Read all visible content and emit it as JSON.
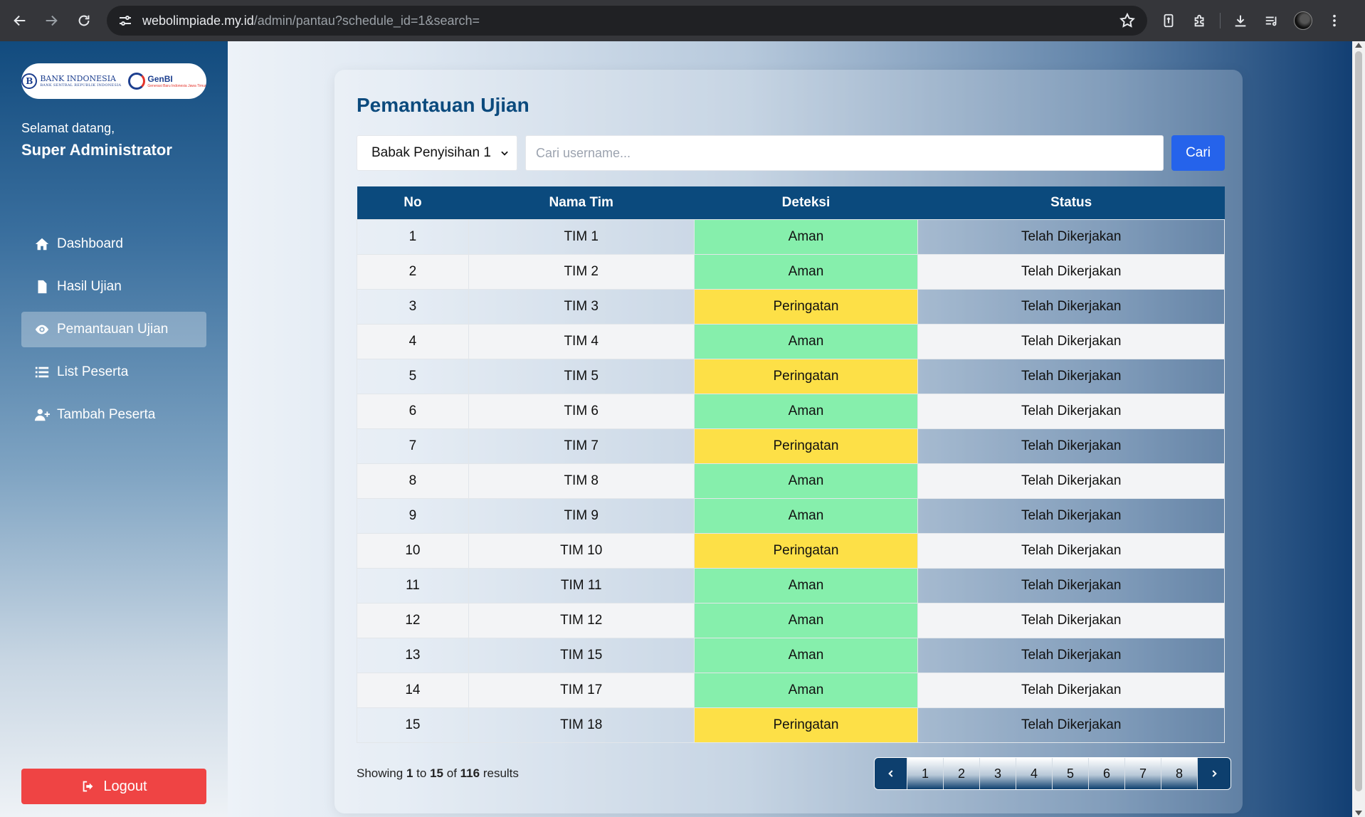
{
  "browser": {
    "url_host": "webolimpiade.my.id",
    "url_rest": "/admin/pantau?schedule_id=1&search="
  },
  "sidebar": {
    "logo_bi_text": "BANK INDONESIA",
    "logo_bi_sub": "BANK SENTRAL REPUBLIK INDONESIA",
    "logo_genbi_text": "GenBI",
    "logo_genbi_sub": "Generasi Baru Indonesia Jawa Timur",
    "welcome": "Selamat datang,",
    "admin_name": "Super Administrator",
    "items": [
      {
        "label": "Dashboard",
        "icon": "home-icon"
      },
      {
        "label": "Hasil Ujian",
        "icon": "file-icon"
      },
      {
        "label": "Pemantauan Ujian",
        "icon": "eye-icon",
        "active": true
      },
      {
        "label": "List Peserta",
        "icon": "list-icon"
      },
      {
        "label": "Tambah Peserta",
        "icon": "user-plus-icon"
      }
    ],
    "logout_label": "Logout"
  },
  "main": {
    "title": "Pemantauan Ujian",
    "select_value": "Babak Penyisihan 1",
    "search_placeholder": "Cari username...",
    "search_button": "Cari",
    "table": {
      "headers": [
        "No",
        "Nama Tim",
        "Deteksi",
        "Status"
      ],
      "rows": [
        [
          "1",
          "TIM 1",
          "Aman",
          "Telah Dikerjakan"
        ],
        [
          "2",
          "TIM 2",
          "Aman",
          "Telah Dikerjakan"
        ],
        [
          "3",
          "TIM 3",
          "Peringatan",
          "Telah Dikerjakan"
        ],
        [
          "4",
          "TIM 4",
          "Aman",
          "Telah Dikerjakan"
        ],
        [
          "5",
          "TIM 5",
          "Peringatan",
          "Telah Dikerjakan"
        ],
        [
          "6",
          "TIM 6",
          "Aman",
          "Telah Dikerjakan"
        ],
        [
          "7",
          "TIM 7",
          "Peringatan",
          "Telah Dikerjakan"
        ],
        [
          "8",
          "TIM 8",
          "Aman",
          "Telah Dikerjakan"
        ],
        [
          "9",
          "TIM 9",
          "Aman",
          "Telah Dikerjakan"
        ],
        [
          "10",
          "TIM 10",
          "Peringatan",
          "Telah Dikerjakan"
        ],
        [
          "11",
          "TIM 11",
          "Aman",
          "Telah Dikerjakan"
        ],
        [
          "12",
          "TIM 12",
          "Aman",
          "Telah Dikerjakan"
        ],
        [
          "13",
          "TIM 15",
          "Aman",
          "Telah Dikerjakan"
        ],
        [
          "14",
          "TIM 17",
          "Aman",
          "Telah Dikerjakan"
        ],
        [
          "15",
          "TIM 18",
          "Peringatan",
          "Telah Dikerjakan"
        ]
      ]
    },
    "showing": {
      "prefix": "Showing",
      "from": "1",
      "to_word": "to",
      "to": "15",
      "of_word": "of",
      "total": "116",
      "suffix": "results"
    },
    "pages": [
      "1",
      "2",
      "3",
      "4",
      "5",
      "6",
      "7",
      "8"
    ]
  },
  "colors": {
    "aman": "#86efac",
    "peringatan": "#fde047",
    "header": "#0b4a7d",
    "primary_button": "#2563eb",
    "logout": "#ef4444"
  }
}
